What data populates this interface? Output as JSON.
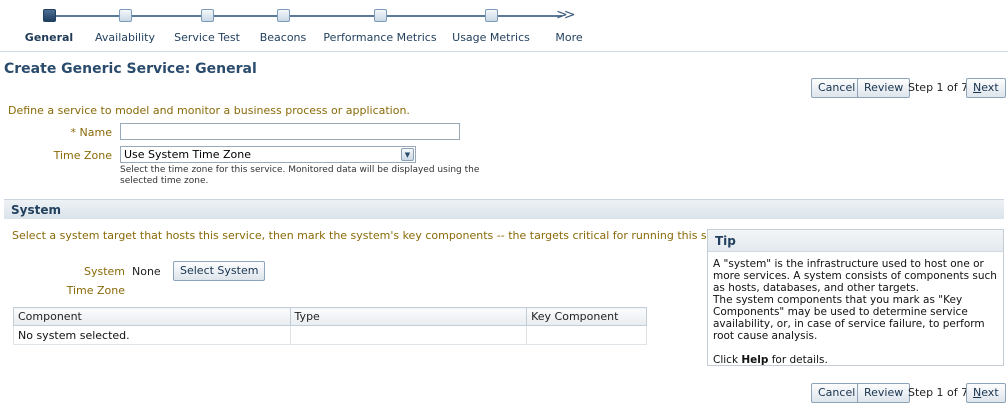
{
  "train": {
    "steps": [
      {
        "label": "General",
        "active": true
      },
      {
        "label": "Availability",
        "active": false
      },
      {
        "label": "Service Test",
        "active": false
      },
      {
        "label": "Beacons",
        "active": false
      },
      {
        "label": "Performance Metrics",
        "active": false
      },
      {
        "label": "Usage Metrics",
        "active": false
      },
      {
        "label": "More",
        "active": false
      }
    ]
  },
  "page": {
    "title": "Create Generic Service: General",
    "intro": "Define a service to model and monitor a business process or application."
  },
  "nav": {
    "cancel": "Cancel",
    "review": "Review",
    "step": "Step 1 of 7",
    "next_first": "N",
    "next_rest": "ext"
  },
  "form": {
    "required_mark": "*",
    "name_label": "Name",
    "name_value": "",
    "tz_label": "Time Zone",
    "tz_value": "Use System Time Zone",
    "tz_hint": "Select the time zone for this service. Monitored data will be displayed using the selected time zone."
  },
  "system": {
    "section_title": "System",
    "intro": "Select a system target that hosts this service, then mark the system's key components -- the targets critical for running this service.",
    "system_label": "System",
    "system_value": "None",
    "select_button": "Select System",
    "tz_label": "Time Zone",
    "table": {
      "headers": [
        "Component",
        "Type",
        "Key Component"
      ],
      "empty_text": "No system selected."
    }
  },
  "tip": {
    "title": "Tip",
    "para1": "A \"system\" is the infrastructure used to host one or more services. A system consists of components such as hosts, databases, and other targets.",
    "para2": "The system components that you mark as \"Key Components\" may be used to determine service availability, or, in case of service failure, to perform root cause analysis.",
    "click_prefix": "Click ",
    "click_bold": "Help",
    "click_suffix": " for details."
  },
  "icons": {
    "select_arrow": "chevron-down-icon",
    "train_end": "double-chevron-right-icon"
  },
  "colors": {
    "accent": "#2a4b6c",
    "label": "#8a6a08"
  }
}
